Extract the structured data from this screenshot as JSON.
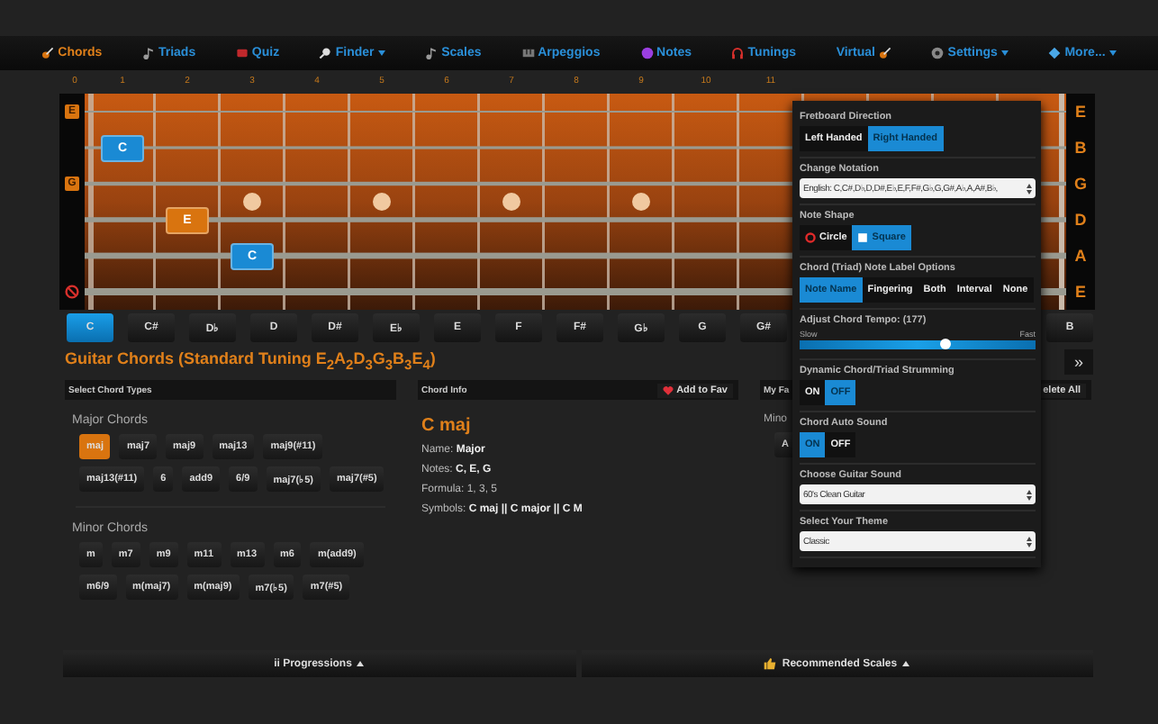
{
  "nav": [
    {
      "label": "Chords",
      "selected": true,
      "dropdown": false
    },
    {
      "label": "Triads",
      "selected": false,
      "dropdown": false
    },
    {
      "label": "Quiz",
      "selected": false,
      "dropdown": false
    },
    {
      "label": "Finder",
      "selected": false,
      "dropdown": true
    },
    {
      "label": "Scales",
      "selected": false,
      "dropdown": false
    },
    {
      "label": "Arpeggios",
      "selected": false,
      "dropdown": false
    },
    {
      "label": "Notes",
      "selected": false,
      "dropdown": false
    },
    {
      "label": "Tunings",
      "selected": false,
      "dropdown": false
    },
    {
      "label": "Virtual",
      "selected": false,
      "dropdown": false
    },
    {
      "label": "Settings",
      "selected": false,
      "dropdown": true
    },
    {
      "label": "More...",
      "selected": false,
      "dropdown": true
    }
  ],
  "fretboard": {
    "fret_numbers": [
      "0",
      "1",
      "2",
      "3",
      "4",
      "5",
      "6",
      "7",
      "8",
      "9",
      "10",
      "11"
    ],
    "strings": [
      {
        "left": "E",
        "right": "E"
      },
      {
        "right": "B",
        "frets": [
          {
            "kind": "blank"
          },
          {
            "kind": "note",
            "label": "C",
            "color": "#1a8ad4"
          }
        ]
      },
      {
        "left": "G",
        "right": "G"
      },
      {
        "right": "D",
        "frets": [
          {
            "kind": "blank"
          },
          {
            "kind": "blank"
          },
          {
            "kind": "note",
            "label": "E",
            "color": "#d9740f"
          }
        ]
      },
      {
        "right": "A",
        "frets": [
          {
            "kind": "blank"
          },
          {
            "kind": "blank"
          },
          {
            "kind": "blank"
          },
          {
            "kind": "note",
            "label": "C",
            "color": "#1a8ad4"
          }
        ]
      },
      {
        "right": "E",
        "muted": true
      }
    ]
  },
  "keys": [
    {
      "label": "C",
      "selected": true
    },
    {
      "label": "C#",
      "selected": false
    },
    {
      "label": "D♭",
      "selected": false
    },
    {
      "label": "D",
      "selected": false
    },
    {
      "label": "D#",
      "selected": false
    },
    {
      "label": "E♭",
      "selected": false
    },
    {
      "label": "E",
      "selected": false
    },
    {
      "label": "F",
      "selected": false
    },
    {
      "label": "F#",
      "selected": false
    },
    {
      "label": "G♭",
      "selected": false
    },
    {
      "label": "G",
      "selected": false
    },
    {
      "label": "G#",
      "selected": false
    },
    {
      "label": "B",
      "selected": false
    }
  ],
  "title": "Guitar Chords (Standard Tuning E$_{2}$A$_{2}$D$_{3}$G$_{3}$B$_{3}$E$_{4}$)",
  "next_button": "»",
  "chord_types": {
    "header": "Select Chord Types",
    "groups": [
      {
        "title": "Major Chords",
        "items": [
          {
            "label": "maj",
            "selected": true
          },
          {
            "label": "maj7",
            "selected": false
          },
          {
            "label": "maj9",
            "selected": false
          },
          {
            "label": "maj13",
            "selected": false
          },
          {
            "label": "maj9(#11)",
            "selected": false
          },
          {
            "label": "maj13(#11)",
            "selected": false
          },
          {
            "label": "6",
            "selected": false
          },
          {
            "label": "add9",
            "selected": false
          },
          {
            "label": "6/9",
            "selected": false
          },
          {
            "label": "maj7(♭5)",
            "selected": false
          },
          {
            "label": "maj7(#5)",
            "selected": false
          }
        ]
      },
      {
        "title": "Minor Chords",
        "items": [
          {
            "label": "m",
            "selected": false
          },
          {
            "label": "m7",
            "selected": false
          },
          {
            "label": "m9",
            "selected": false
          },
          {
            "label": "m11",
            "selected": false
          },
          {
            "label": "m13",
            "selected": false
          },
          {
            "label": "m6",
            "selected": false
          },
          {
            "label": "m(add9)",
            "selected": false
          },
          {
            "label": "m6/9",
            "selected": false
          },
          {
            "label": "m(maj7)",
            "selected": false
          },
          {
            "label": "m(maj9)",
            "selected": false
          },
          {
            "label": "m7(♭5)",
            "selected": false
          },
          {
            "label": "m7(#5)",
            "selected": false
          }
        ]
      }
    ]
  },
  "chord_info": {
    "header": "Chord Info",
    "fav_button": "Add to Fav",
    "name": "C maj",
    "lines": [
      "Name: **Major**",
      "Notes: **C, E, G**",
      "Formula: 1, 3, 5",
      "Symbols: **C maj || C major || C M**"
    ]
  },
  "favorites": {
    "header": "My Fa",
    "delete_button": "elete All",
    "group": "Mino",
    "chip": "A"
  },
  "settings_menu": [
    {
      "kind": "segmented",
      "label": "Fretboard Direction",
      "options": [
        {
          "label": "Left Handed",
          "selected": false
        },
        {
          "label": "Right Handed",
          "selected": true
        }
      ]
    },
    {
      "kind": "select",
      "label": "Change Notation",
      "value": "English: C,C#,D♭,D,D#,E♭,E,F,F#,G♭,G,G#,A♭,A,A#,B♭,"
    },
    {
      "kind": "segmented",
      "label": "Note Shape",
      "options": [
        {
          "label": "Circle",
          "selected": false,
          "kind": "circle"
        },
        {
          "label": "Square",
          "selected": true,
          "kind": "square"
        }
      ]
    },
    {
      "kind": "segmented",
      "label": "Chord (Triad) Note Label Options",
      "options": [
        {
          "label": "Note Name",
          "selected": true
        },
        {
          "label": "Fingering",
          "selected": false
        },
        {
          "label": "Both",
          "selected": false
        },
        {
          "label": "Interval",
          "selected": false
        },
        {
          "label": "None",
          "selected": false
        }
      ]
    },
    {
      "kind": "slider",
      "label": "Adjust Chord Tempo: (177)",
      "min_label": "Slow",
      "max_label": "Fast",
      "level": 0.62
    },
    {
      "kind": "segmented",
      "label": "Dynamic Chord/Triad Strumming",
      "options": [
        {
          "label": "ON",
          "selected": false
        },
        {
          "label": "OFF",
          "selected": true
        }
      ]
    },
    {
      "kind": "segmented",
      "label": "Chord Auto Sound",
      "options": [
        {
          "label": "ON",
          "selected": true
        },
        {
          "label": "OFF",
          "selected": false
        }
      ]
    },
    {
      "kind": "select",
      "label": "Choose Guitar Sound",
      "value": "60's Clean Guitar"
    },
    {
      "kind": "select",
      "label": "Select Your Theme",
      "value": "Classic"
    }
  ],
  "bottom_bars": [
    {
      "label": "ii Progressions"
    },
    {
      "label": "Recommended Scales"
    }
  ]
}
